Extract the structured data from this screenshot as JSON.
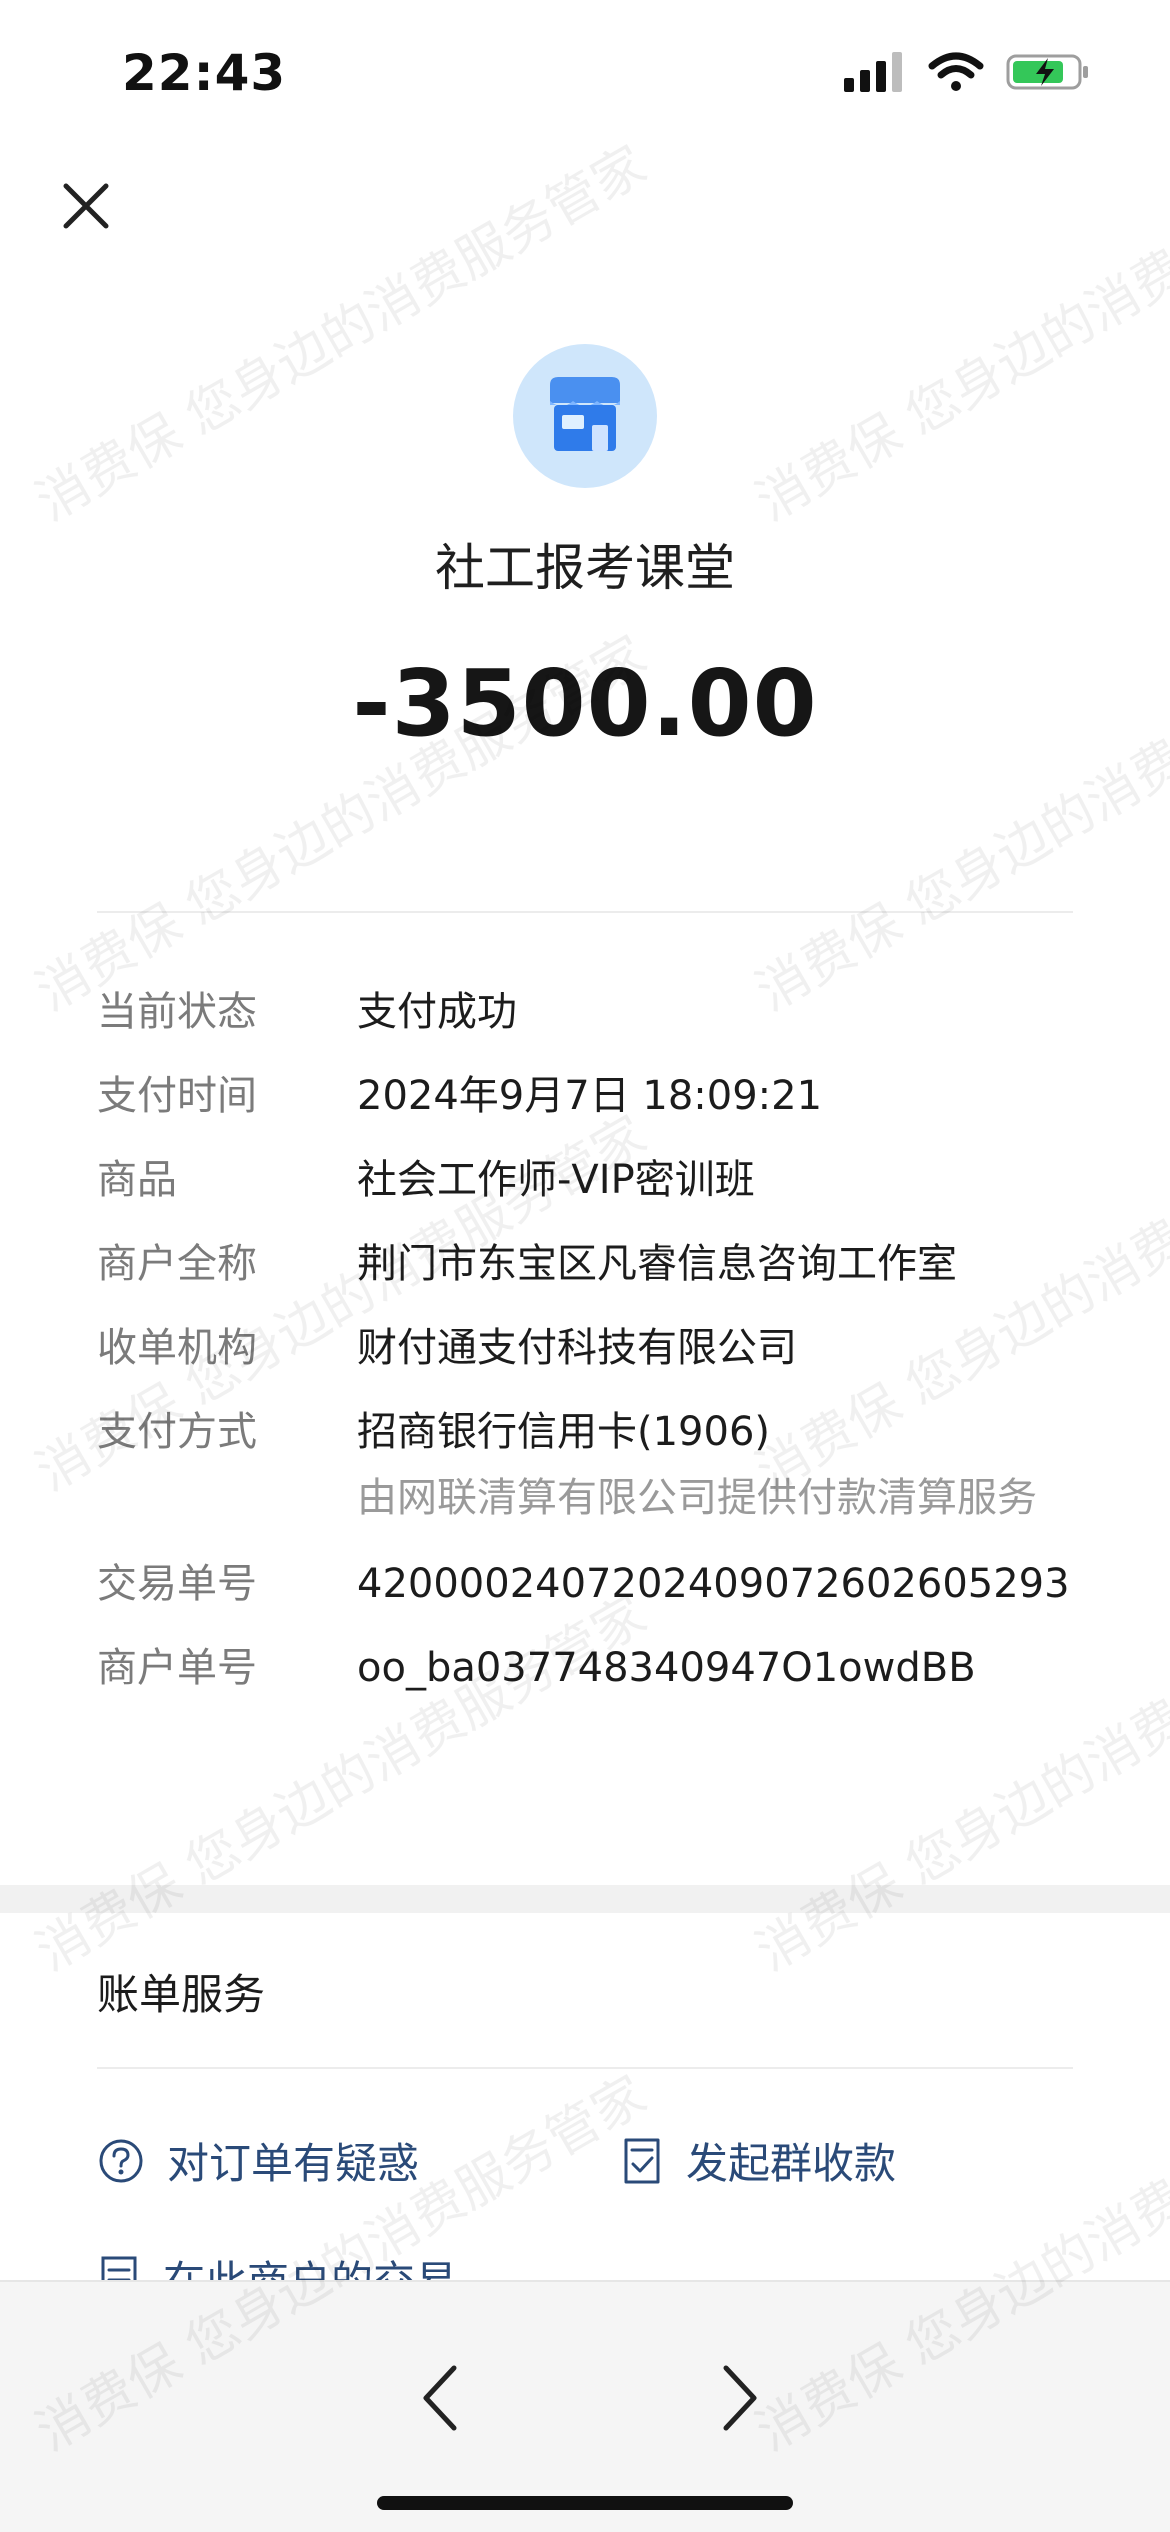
{
  "status_bar": {
    "time": "22:43",
    "icons": [
      "signal-icon",
      "wifi-icon",
      "battery-charging-icon"
    ]
  },
  "header": {
    "close_icon": "close-icon"
  },
  "merchant": {
    "logo_icon": "store-icon",
    "name": "社工报考课堂",
    "amount": "-3500.00"
  },
  "details": [
    {
      "label": "当前状态",
      "value": "支付成功"
    },
    {
      "label": "支付时间",
      "value": "2024年9月7日 18:09:21"
    },
    {
      "label": "商品",
      "value": "社会工作师-VIP密训班"
    },
    {
      "label": "商户全称",
      "value": "荆门市东宝区凡睿信息咨询工作室"
    },
    {
      "label": "收单机构",
      "value": "财付通支付科技有限公司"
    },
    {
      "label": "支付方式",
      "value": "招商银行信用卡(1906)",
      "sub": "由网联清算有限公司提供付款清算服务"
    },
    {
      "label": "交易单号",
      "value": "4200002407202409072602605293"
    },
    {
      "label": "商户单号",
      "value": "oo_ba037748340947O1owdBB"
    }
  ],
  "bill_service": {
    "title": "账单服务",
    "items": [
      {
        "label": "对订单有疑惑",
        "icon": "question-circle-icon"
      },
      {
        "label": "发起群收款",
        "icon": "receipt-check-icon"
      },
      {
        "label": "在此商户的交易",
        "icon": "list-document-icon"
      }
    ]
  },
  "bottom_nav": {
    "back_icon": "chevron-left-icon",
    "forward_icon": "chevron-right-icon"
  },
  "watermark": {
    "text": "消费保 您身边的消费服务管家"
  },
  "colors": {
    "link": "#2a4a78",
    "label_gray": "#7b7b7b",
    "logo_bg": "#cfe6fb",
    "battery_green": "#34c759"
  }
}
